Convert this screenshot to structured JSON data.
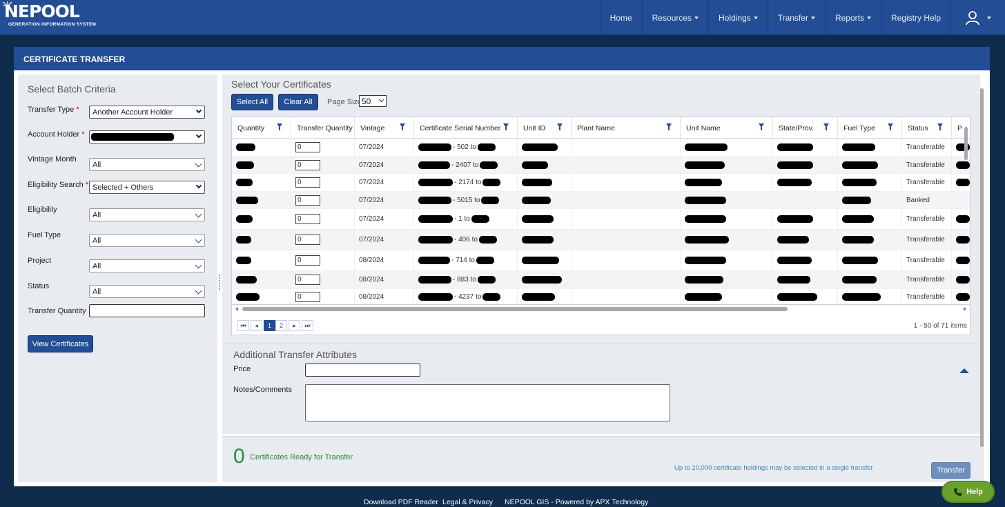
{
  "nav": {
    "logo_main": "NEPOOL",
    "logo_sub": "GENERATION INFORMATION SYSTEM",
    "items": [
      {
        "label": "Home",
        "dropdown": false
      },
      {
        "label": "Resources",
        "dropdown": true
      },
      {
        "label": "Holdings",
        "dropdown": true
      },
      {
        "label": "Transfer",
        "dropdown": true
      },
      {
        "label": "Reports",
        "dropdown": true
      },
      {
        "label": "Registry Help",
        "dropdown": false
      }
    ],
    "user_icon": "user-icon"
  },
  "card": {
    "title": "CERTIFICATE TRANSFER"
  },
  "criteria": {
    "title": "Select Batch Criteria",
    "transfer_type": {
      "label": "Transfer Type",
      "value": "Another Account Holder"
    },
    "account_holder": {
      "label": "Account Holder",
      "value": ""
    },
    "vintage_month": {
      "label": "Vintage Month",
      "value": "All"
    },
    "eligibility_search": {
      "label": "Eligibility Search",
      "value": "Selected + Others"
    },
    "eligibility": {
      "label": "Eligibility",
      "value": "All"
    },
    "fuel_type": {
      "label": "Fuel Type",
      "value": "All"
    },
    "project": {
      "label": "Project",
      "value": "All"
    },
    "status": {
      "label": "Status",
      "value": "All"
    },
    "transfer_quantity": {
      "label": "Transfer Quantity",
      "value": ""
    },
    "view_button": "View Certificates"
  },
  "certs": {
    "title": "Select Your Certificates",
    "select_all": "Select All",
    "clear_all": "Clear All",
    "page_size_label": "Page Size",
    "page_size": "50",
    "columns": [
      "Quantity",
      "Transfer Quantity",
      "Vintage",
      "Certificate Serial Number",
      "Unit ID",
      "Plant Name",
      "Unit Name",
      "State/Prov.",
      "Fuel Type",
      "Status",
      "P"
    ],
    "rows": [
      {
        "transfer_qty": "0",
        "vintage": "07/2024",
        "serial": "- 502 to",
        "status": "Transferable"
      },
      {
        "transfer_qty": "0",
        "vintage": "07/2024",
        "serial": "- 2407 to",
        "status": "Transferable"
      },
      {
        "transfer_qty": "0",
        "vintage": "07/2024",
        "serial": "- 2174 to",
        "status": "Transferable"
      },
      {
        "transfer_qty": "0",
        "vintage": "07/2024",
        "serial": "- 5015 to",
        "status": "Banked"
      },
      {
        "transfer_qty": "0",
        "vintage": "07/2024",
        "serial": "- 1 to",
        "status": "Transferable"
      },
      {
        "transfer_qty": "0",
        "vintage": "07/2024",
        "serial": "- 406 to",
        "status": "Transferable"
      },
      {
        "transfer_qty": "0",
        "vintage": "08/2024",
        "serial": "- 714 to",
        "status": "Transferable"
      },
      {
        "transfer_qty": "0",
        "vintage": "08/2024",
        "serial": "- 883 to",
        "status": "Transferable"
      },
      {
        "transfer_qty": "0",
        "vintage": "08/2024",
        "serial": "- 4237 to",
        "status": "Transferable"
      }
    ],
    "pages": [
      "1",
      "2"
    ],
    "current_page": "1",
    "items_info": "1 - 50 of 71 items"
  },
  "attrs": {
    "title": "Additional Transfer Attributes",
    "price_label": "Price",
    "price_value": "",
    "notes_label": "Notes/Comments",
    "notes_value": ""
  },
  "ready": {
    "count": "0",
    "label": "Certificates Ready for Transfer",
    "limit_note": "Up to 20,000 certificate holdings may be selected in a single transfer",
    "transfer_button": "Transfer"
  },
  "footer": {
    "links": [
      "Download PDF Reader",
      "Legal & Privacy",
      "NEPOOL GIS - Powered by APX Technology"
    ],
    "help": "Help"
  },
  "colors": {
    "primary": "#234d94",
    "background": "#0f2c4d",
    "success": "#2c8a3c",
    "help": "#6aa02c"
  }
}
